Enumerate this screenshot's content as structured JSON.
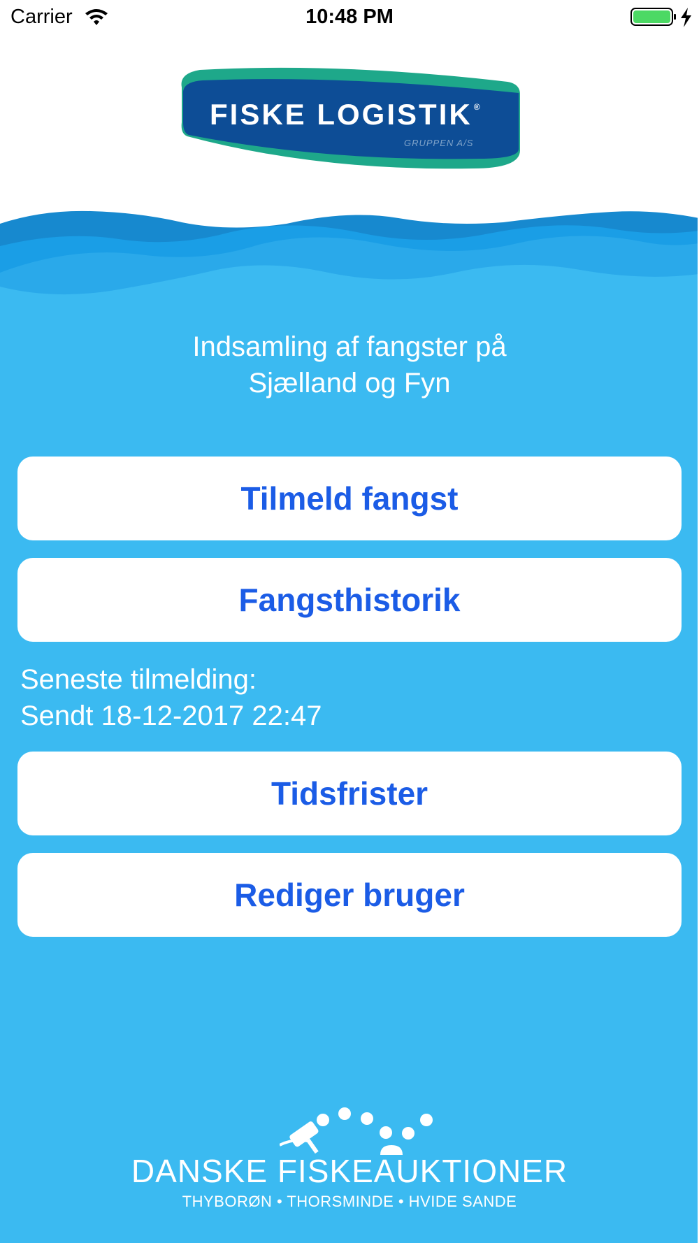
{
  "status_bar": {
    "carrier": "Carrier",
    "time": "10:48 PM",
    "battery_level": 1.0
  },
  "header_logo": {
    "brand_part1": "FISKE",
    "brand_part2": "LOGISTIK",
    "registered_mark": "®",
    "sub": "GRUPPEN A/S"
  },
  "main": {
    "subtitle_line1": "Indsamling af fangster på",
    "subtitle_line2": "Sjælland og Fyn",
    "buttons": [
      {
        "label": "Tilmeld fangst"
      },
      {
        "label": "Fangsthistorik"
      },
      {
        "label": "Tidsfrister"
      },
      {
        "label": "Rediger bruger"
      }
    ],
    "latest_label": "Seneste tilmelding:",
    "latest_value": "Sendt 18-12-2017 22:47"
  },
  "footer_logo": {
    "name": "DANSKE FISKEAUKTIONER",
    "places": "THYBORØN • THORSMINDE • HVIDE SANDE"
  },
  "colors": {
    "sea": "#3bbaf1",
    "button_text": "#1b5ce6",
    "logo_blue": "#0d4d96",
    "logo_green": "#1ea88a"
  }
}
